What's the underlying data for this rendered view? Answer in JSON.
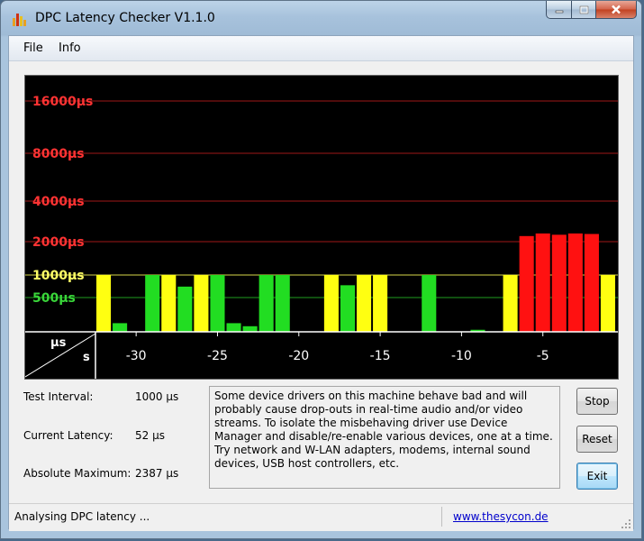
{
  "window": {
    "title": "DPC Latency Checker V1.1.0",
    "controls": {
      "minimize_icon": "minimize-icon",
      "maximize_icon": "maximize-icon",
      "close_icon": "close-icon"
    }
  },
  "menu": {
    "items": [
      "File",
      "Info"
    ]
  },
  "chart_data": {
    "type": "bar",
    "title": "",
    "xlabel": "s",
    "ylabel": "µs",
    "y_scale": "log",
    "y_tick_labels": [
      "500µs",
      "1000µs",
      "2000µs",
      "4000µs",
      "8000µs",
      "16000µs"
    ],
    "y_tick_values": [
      500,
      1000,
      2000,
      4000,
      8000,
      16000
    ],
    "y_tick_colors": [
      "#39d539",
      "#ffff66",
      "#ff3333",
      "#ff3333",
      "#ff3333",
      "#ff3333"
    ],
    "x_tick_labels": [
      "-30",
      "-25",
      "-20",
      "-15",
      "-10",
      "-5"
    ],
    "x_tick_values": [
      -30,
      -25,
      -20,
      -15,
      -10,
      -5
    ],
    "x_range": [
      -32.5,
      -0.5
    ],
    "grid": true,
    "color_thresholds": {
      "green_below": 1000,
      "yellow_below": 2000,
      "red_from": 2000
    },
    "colors": {
      "green": "#22dd22",
      "yellow": "#ffff11",
      "red": "#ff1111",
      "background": "#000000"
    },
    "x": [
      -32,
      -31,
      -30,
      -29,
      -28,
      -27,
      -26,
      -25,
      -24,
      -23,
      -22,
      -21,
      -20,
      -19,
      -18,
      -17,
      -16,
      -15,
      -14,
      -13,
      -12,
      -11,
      -10,
      -9,
      -8,
      -7,
      -6,
      -5,
      -4,
      -3,
      -2,
      -1
    ],
    "values": [
      1000,
      150,
      100,
      1000,
      1000,
      700,
      1000,
      1000,
      150,
      130,
      1000,
      1000,
      100,
      100,
      1000,
      730,
      1000,
      1000,
      100,
      100,
      1000,
      100,
      100,
      110,
      100,
      1000,
      2200,
      2300,
      2250,
      2300,
      2280,
      1000
    ],
    "bar_colors": [
      "yellow",
      "green",
      "green",
      "green",
      "yellow",
      "green",
      "yellow",
      "green",
      "green",
      "green",
      "green",
      "green",
      "green",
      "green",
      "yellow",
      "green",
      "yellow",
      "yellow",
      "green",
      "green",
      "green",
      "green",
      "green",
      "green",
      "green",
      "yellow",
      "red",
      "red",
      "red",
      "red",
      "red",
      "yellow"
    ]
  },
  "info": {
    "test_interval_label": "Test Interval:",
    "test_interval_value": "1000 µs",
    "current_latency_label": "Current Latency:",
    "current_latency_value": "52 µs",
    "absolute_maximum_label": "Absolute Maximum:",
    "absolute_maximum_value": "2387 µs"
  },
  "description": "Some device drivers on this machine behave bad and will probably cause drop-outs in real-time audio and/or video streams. To isolate the misbehaving driver use Device Manager and disable/re-enable various devices, one at a time. Try network and W-LAN adapters, modems, internal sound devices, USB host controllers, etc.",
  "buttons": {
    "stop": "Stop",
    "reset": "Reset",
    "exit": "Exit"
  },
  "status": {
    "text": "Analysing DPC latency ...",
    "link": "www.thesycon.de"
  }
}
